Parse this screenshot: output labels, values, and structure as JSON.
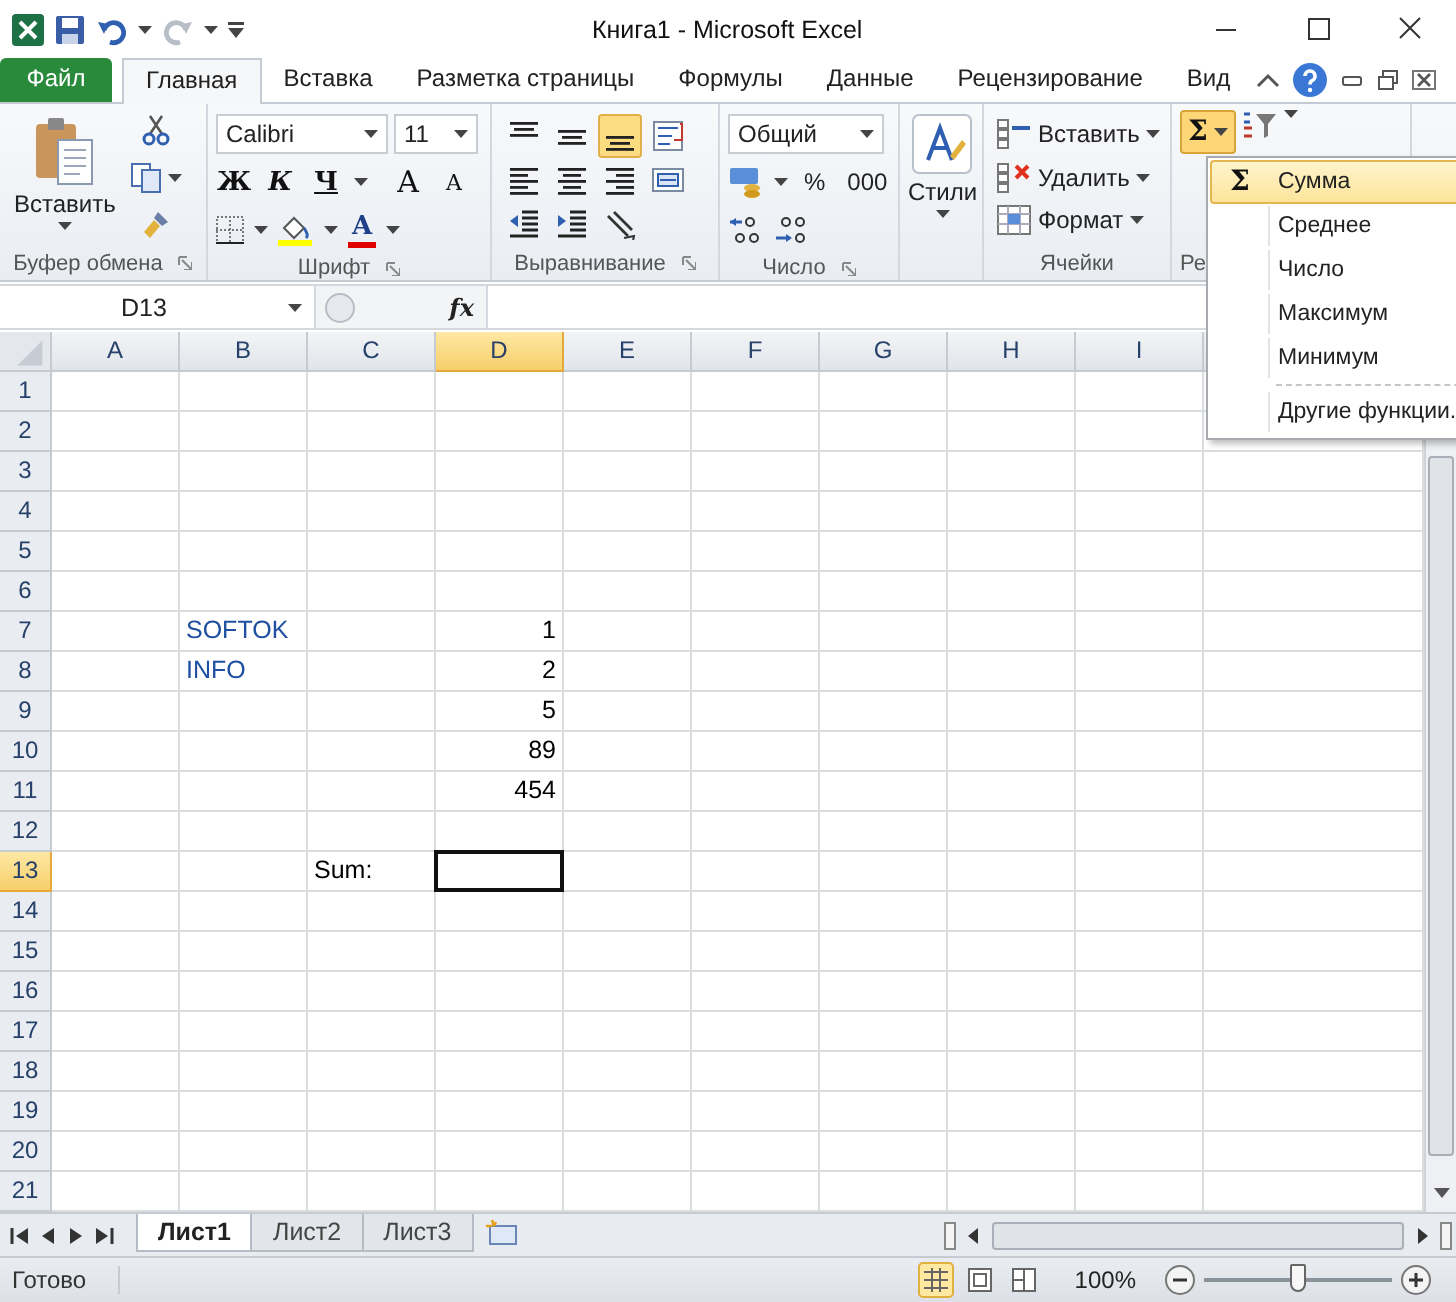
{
  "window": {
    "title": "Книга1 - Microsoft Excel"
  },
  "tabs": [
    {
      "label": "Файл",
      "kind": "file",
      "selected": false
    },
    {
      "label": "Главная",
      "kind": "tab",
      "selected": true
    },
    {
      "label": "Вставка",
      "kind": "tab",
      "selected": false
    },
    {
      "label": "Разметка страницы",
      "kind": "tab",
      "selected": false
    },
    {
      "label": "Формулы",
      "kind": "tab",
      "selected": false
    },
    {
      "label": "Данные",
      "kind": "tab",
      "selected": false
    },
    {
      "label": "Рецензирование",
      "kind": "tab",
      "selected": false
    },
    {
      "label": "Вид",
      "kind": "tab",
      "selected": false
    }
  ],
  "ribbon": {
    "clipboard": {
      "label": "Буфер обмена",
      "paste": "Вставить"
    },
    "font": {
      "label": "Шрифт",
      "font": "Calibri",
      "size": "11",
      "bold": "Ж",
      "italic": "К",
      "underline": "Ч",
      "grow": "A",
      "shrink": "A",
      "color_letter": "A"
    },
    "alignment": {
      "label": "Выравнивание",
      "buttons": [
        {
          "kind": "top",
          "selected": false
        },
        {
          "kind": "middle",
          "selected": false
        },
        {
          "kind": "bottom",
          "selected": true
        },
        {
          "kind": "wrap",
          "selected": false
        },
        {
          "kind": "left",
          "selected": false
        },
        {
          "kind": "center",
          "selected": false
        },
        {
          "kind": "right",
          "selected": false
        },
        {
          "kind": "merge",
          "selected": false
        },
        {
          "kind": "outdent",
          "selected": false
        },
        {
          "kind": "indent",
          "selected": false
        },
        {
          "kind": "orientation",
          "selected": false
        }
      ]
    },
    "number": {
      "label": "Число",
      "format": "Общий",
      "percent": "%",
      "thousands": "000"
    },
    "styles": {
      "button": "Стили"
    },
    "cells": {
      "label": "Ячейки",
      "items": [
        {
          "kind": "insert",
          "label": "Вставить"
        },
        {
          "kind": "delete",
          "label": "Удалить"
        },
        {
          "kind": "format",
          "label": "Формат"
        }
      ]
    },
    "editing": {
      "label": "Ре",
      "sum": "Σ",
      "pressed": true
    }
  },
  "autosum_menu": [
    {
      "icon": "Σ",
      "label": "Сумма",
      "selected": true,
      "divider_above": false
    },
    {
      "label": "Среднее",
      "selected": false,
      "divider_above": false
    },
    {
      "label": "Число",
      "selected": false,
      "divider_above": false
    },
    {
      "label": "Максимум",
      "selected": false,
      "divider_above": false
    },
    {
      "label": "Минимум",
      "selected": false,
      "divider_above": false
    },
    {
      "label": "Другие функции.",
      "selected": false,
      "divider_above": true
    }
  ],
  "formula_bar": {
    "name_box": "D13",
    "fx": "fx"
  },
  "columns": [
    {
      "label": "A",
      "selected": false
    },
    {
      "label": "B",
      "selected": false
    },
    {
      "label": "C",
      "selected": false
    },
    {
      "label": "D",
      "selected": true
    },
    {
      "label": "E",
      "selected": false
    },
    {
      "label": "F",
      "selected": false
    },
    {
      "label": "G",
      "selected": false
    },
    {
      "label": "H",
      "selected": false
    },
    {
      "label": "I",
      "selected": false
    }
  ],
  "rows": [
    {
      "label": "1",
      "selected": false
    },
    {
      "label": "2",
      "selected": false
    },
    {
      "label": "3",
      "selected": false
    },
    {
      "label": "4",
      "selected": false
    },
    {
      "label": "5",
      "selected": false
    },
    {
      "label": "6",
      "selected": false
    },
    {
      "label": "7",
      "selected": false,
      "cells": {
        "B": {
          "text": "SOFTOK",
          "kind": "text",
          "color": "#1f4fa0"
        },
        "D": {
          "text": "1",
          "kind": "number"
        }
      }
    },
    {
      "label": "8",
      "selected": false,
      "cells": {
        "B": {
          "text": "INFO",
          "kind": "text",
          "color": "#1f4fa0"
        },
        "D": {
          "text": "2",
          "kind": "number"
        }
      }
    },
    {
      "label": "9",
      "selected": false,
      "cells": {
        "D": {
          "text": "5",
          "kind": "number"
        }
      }
    },
    {
      "label": "10",
      "selected": false,
      "cells": {
        "D": {
          "text": "89",
          "kind": "number"
        }
      }
    },
    {
      "label": "11",
      "selected": false,
      "cells": {
        "D": {
          "text": "454",
          "kind": "number"
        }
      }
    },
    {
      "label": "12",
      "selected": false
    },
    {
      "label": "13",
      "selected": true,
      "cells": {
        "C": {
          "text": "Sum:",
          "kind": "text",
          "color": "#000000"
        }
      }
    },
    {
      "label": "14",
      "selected": false
    },
    {
      "label": "15",
      "selected": false
    },
    {
      "label": "16",
      "selected": false
    },
    {
      "label": "17",
      "selected": false
    },
    {
      "label": "18",
      "selected": false
    },
    {
      "label": "19",
      "selected": false
    },
    {
      "label": "20",
      "selected": false
    },
    {
      "label": "21",
      "selected": false
    }
  ],
  "sheet_tabs": [
    {
      "label": "Лист1",
      "selected": true
    },
    {
      "label": "Лист2",
      "selected": false
    },
    {
      "label": "Лист3",
      "selected": false
    }
  ],
  "status_bar": {
    "status": "Готово",
    "zoom": "100%",
    "zoom_level": {
      "level": 0.5
    }
  }
}
